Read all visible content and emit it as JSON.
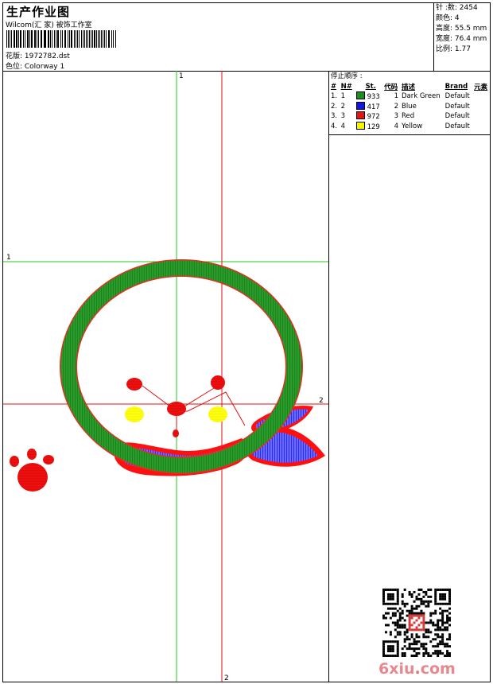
{
  "header": {
    "title": "生产作业图",
    "company": "Wilcom(汇 家) 被饰工作室",
    "design_label": "花版: 1972782.dst",
    "colorway_label": "色位:  Colorway 1"
  },
  "stats": {
    "stitches": "针 :数: 2454",
    "colors": "颜色: 4",
    "height": "高度: 55.5 mm",
    "width": "宽度: 76.4 mm",
    "scale": "比例: 1.77"
  },
  "stop_sequence": {
    "title": "停止顺序 :",
    "columns": [
      "#",
      "N#",
      "St.",
      "代码",
      "描述",
      "Brand",
      "元素"
    ],
    "rows": [
      {
        "idx": "1.",
        "needle": "1",
        "color": "#1e8c1e",
        "stitches": "933",
        "code": "1",
        "desc": "Dark Green",
        "brand": "Default"
      },
      {
        "idx": "2.",
        "needle": "2",
        "color": "#1414e6",
        "stitches": "417",
        "code": "2",
        "desc": "Blue",
        "brand": "Default"
      },
      {
        "idx": "3.",
        "needle": "3",
        "color": "#e61414",
        "stitches": "972",
        "code": "3",
        "desc": "Red",
        "brand": "Default"
      },
      {
        "idx": "4.",
        "needle": "4",
        "color": "#f5f500",
        "stitches": "129",
        "code": "4",
        "desc": "Yellow",
        "brand": "Default"
      }
    ]
  },
  "guides": {
    "green_top_label": "1",
    "green_left_label": "1",
    "red_right_label": "2",
    "red_bottom_label": "2",
    "green_color": "#22cc22",
    "red_color": "#e01010"
  },
  "watermark": {
    "site": "6xiu",
    "dot": ".",
    "tld": "com"
  }
}
